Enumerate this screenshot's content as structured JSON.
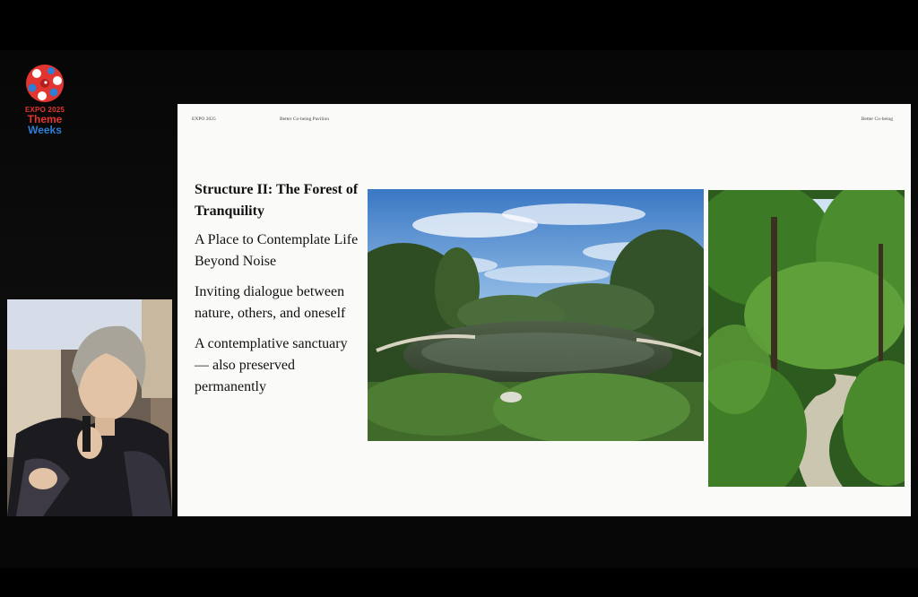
{
  "logo": {
    "line1": "EXPO 2025",
    "line2": "Theme",
    "line3": "Weeks",
    "icon": "expo-logo-icon"
  },
  "slide": {
    "header_left": "EXPO 2025",
    "header_center": "Better Co-being Pavilion",
    "header_right": "Better Co-being",
    "title": "Structure II: The Forest of Tranquility",
    "points": [
      "A Place to Contemplate Life Beyond Noise",
      "Inviting dialogue between nature, others, and oneself",
      "A contemplative sanctuary — also preserved permanently"
    ],
    "images": [
      "pond-photo",
      "forest-path-photo"
    ]
  },
  "speaker_video": {
    "icon": "speaker-video-feed"
  },
  "colors": {
    "background": "#000000",
    "slide_bg": "#fafaf8",
    "logo_red": "#e3352f",
    "logo_blue": "#2d7fd6"
  }
}
